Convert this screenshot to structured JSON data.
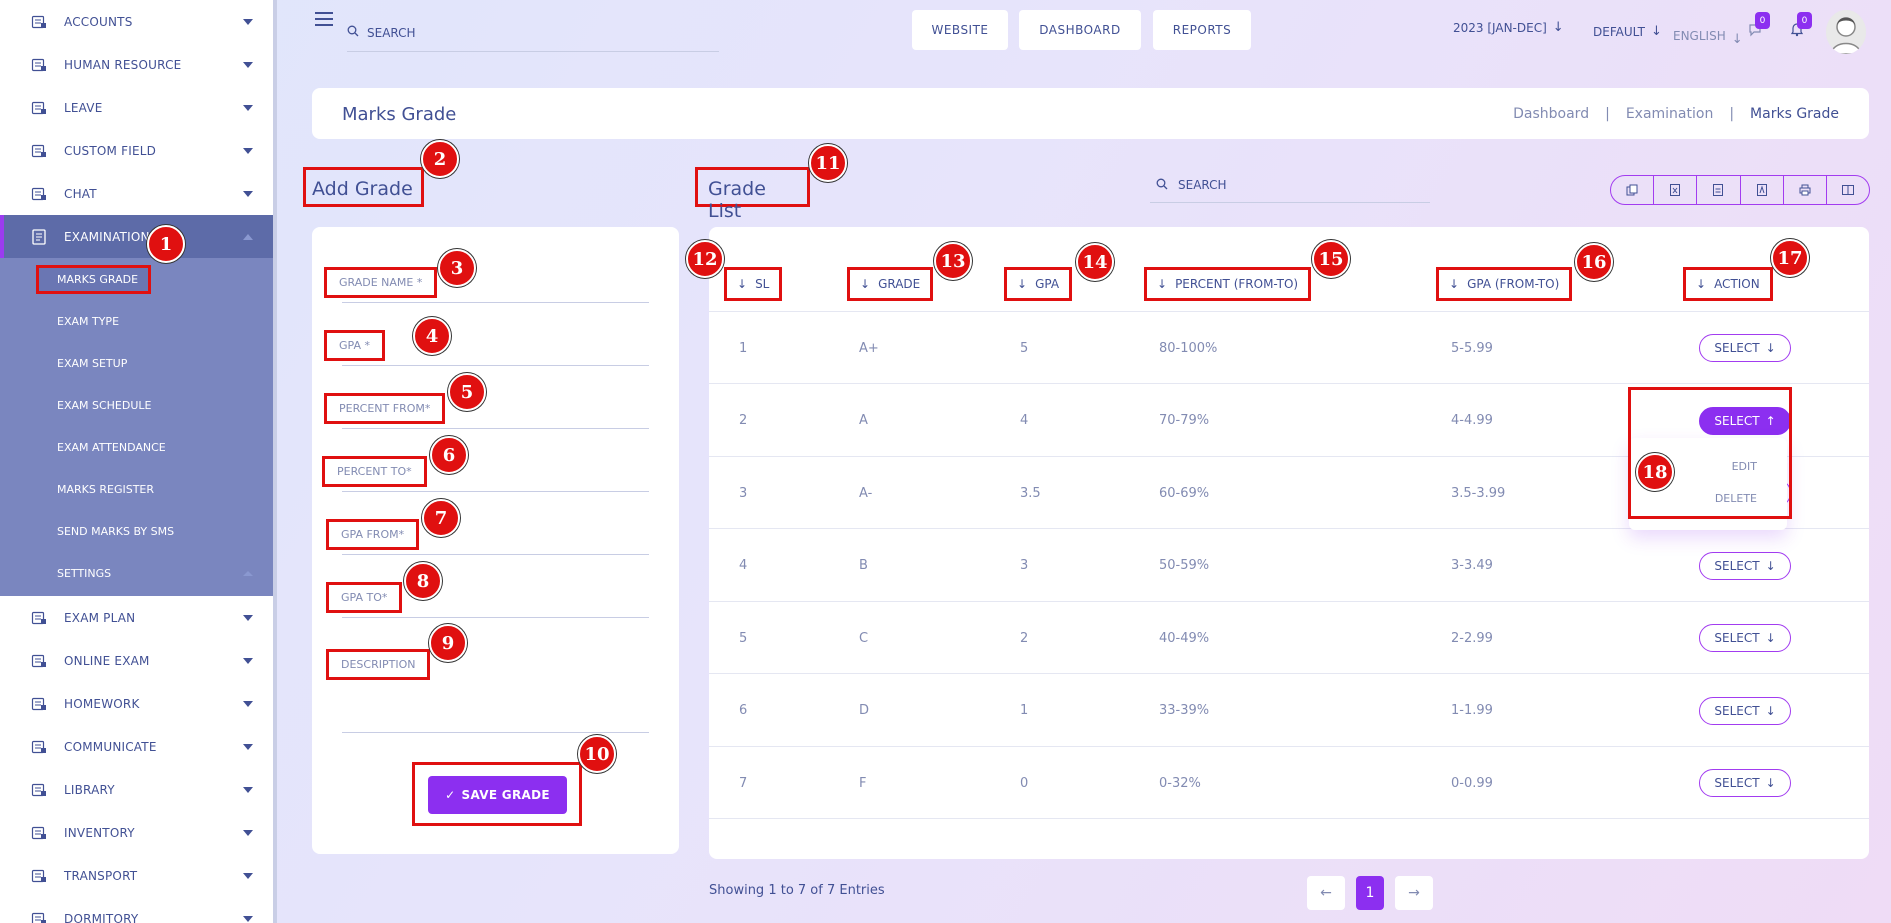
{
  "sidebar": {
    "items_top": [
      {
        "label": "ACCOUNTS",
        "icon": "accounts-icon"
      },
      {
        "label": "HUMAN RESOURCE",
        "icon": "human-resource-icon"
      },
      {
        "label": "LEAVE",
        "icon": "leave-icon"
      },
      {
        "label": "CUSTOM FIELD",
        "icon": "custom-field-icon"
      },
      {
        "label": "CHAT",
        "icon": "chat-icon"
      }
    ],
    "active": {
      "label": "EXAMINATION",
      "icon": "examination-icon"
    },
    "submenu": [
      "MARKS GRADE",
      "EXAM TYPE",
      "EXAM SETUP",
      "EXAM SCHEDULE",
      "EXAM ATTENDANCE",
      "MARKS REGISTER",
      "SEND MARKS BY SMS",
      "SETTINGS"
    ],
    "items_bottom": [
      {
        "label": "EXAM PLAN",
        "icon": "exam-plan-icon"
      },
      {
        "label": "ONLINE EXAM",
        "icon": "online-exam-icon"
      },
      {
        "label": "HOMEWORK",
        "icon": "homework-icon"
      },
      {
        "label": "COMMUNICATE",
        "icon": "communicate-icon"
      },
      {
        "label": "LIBRARY",
        "icon": "library-icon"
      },
      {
        "label": "INVENTORY",
        "icon": "inventory-icon"
      },
      {
        "label": "TRANSPORT",
        "icon": "transport-icon"
      },
      {
        "label": "DORMITORY",
        "icon": "dormitory-icon"
      }
    ]
  },
  "topbar": {
    "search_label": "SEARCH",
    "buttons": [
      "WEBSITE",
      "DASHBOARD",
      "REPORTS"
    ],
    "session": "2023 [JAN-DEC]",
    "theme": "DEFAULT",
    "language": "ENGLISH",
    "message_count": "0",
    "notification_count": "0"
  },
  "header": {
    "title": "Marks Grade",
    "breadcrumb": [
      "Dashboard",
      "Examination",
      "Marks Grade"
    ]
  },
  "add_grade": {
    "title": "Add Grade",
    "fields": {
      "grade_name": "GRADE NAME *",
      "gpa": "GPA *",
      "percent_from": "PERCENT FROM*",
      "percent_to": "PERCENT TO*",
      "gpa_from": "GPA FROM*",
      "gpa_to": "GPA TO*",
      "description": "DESCRIPTION"
    },
    "save_label": "SAVE GRADE"
  },
  "grade_list": {
    "title": "Grade List",
    "search_label": "SEARCH",
    "columns": {
      "sl": "SL",
      "grade": "GRADE",
      "gpa": "GPA",
      "percent": "PERCENT (FROM-TO)",
      "gpa_range": "GPA (FROM-TO)",
      "action": "ACTION"
    },
    "rows": [
      {
        "sl": "1",
        "grade": "A+",
        "gpa": "5",
        "percent": "80-100%",
        "gpa_range": "5-5.99"
      },
      {
        "sl": "2",
        "grade": "A",
        "gpa": "4",
        "percent": "70-79%",
        "gpa_range": "4-4.99"
      },
      {
        "sl": "3",
        "grade": "A-",
        "gpa": "3.5",
        "percent": "60-69%",
        "gpa_range": "3.5-3.99"
      },
      {
        "sl": "4",
        "grade": "B",
        "gpa": "3",
        "percent": "50-59%",
        "gpa_range": "3-3.49"
      },
      {
        "sl": "5",
        "grade": "C",
        "gpa": "2",
        "percent": "40-49%",
        "gpa_range": "2-2.99"
      },
      {
        "sl": "6",
        "grade": "D",
        "gpa": "1",
        "percent": "33-39%",
        "gpa_range": "1-1.99"
      },
      {
        "sl": "7",
        "grade": "F",
        "gpa": "0",
        "percent": "0-32%",
        "gpa_range": "0-0.99"
      }
    ],
    "select_label": "SELECT",
    "dropdown": {
      "edit": "EDIT",
      "delete": "DELETE"
    },
    "footer": "Showing 1 to 7 of 7 Entries",
    "page": "1"
  },
  "markers": [
    "1",
    "2",
    "3",
    "4",
    "5",
    "6",
    "7",
    "8",
    "9",
    "10",
    "11",
    "12",
    "13",
    "14",
    "15",
    "16",
    "17",
    "18"
  ],
  "colors": {
    "accent": "#8c2ff0",
    "text": "#415094",
    "muted": "#828bb2",
    "annotation": "#e01010"
  }
}
